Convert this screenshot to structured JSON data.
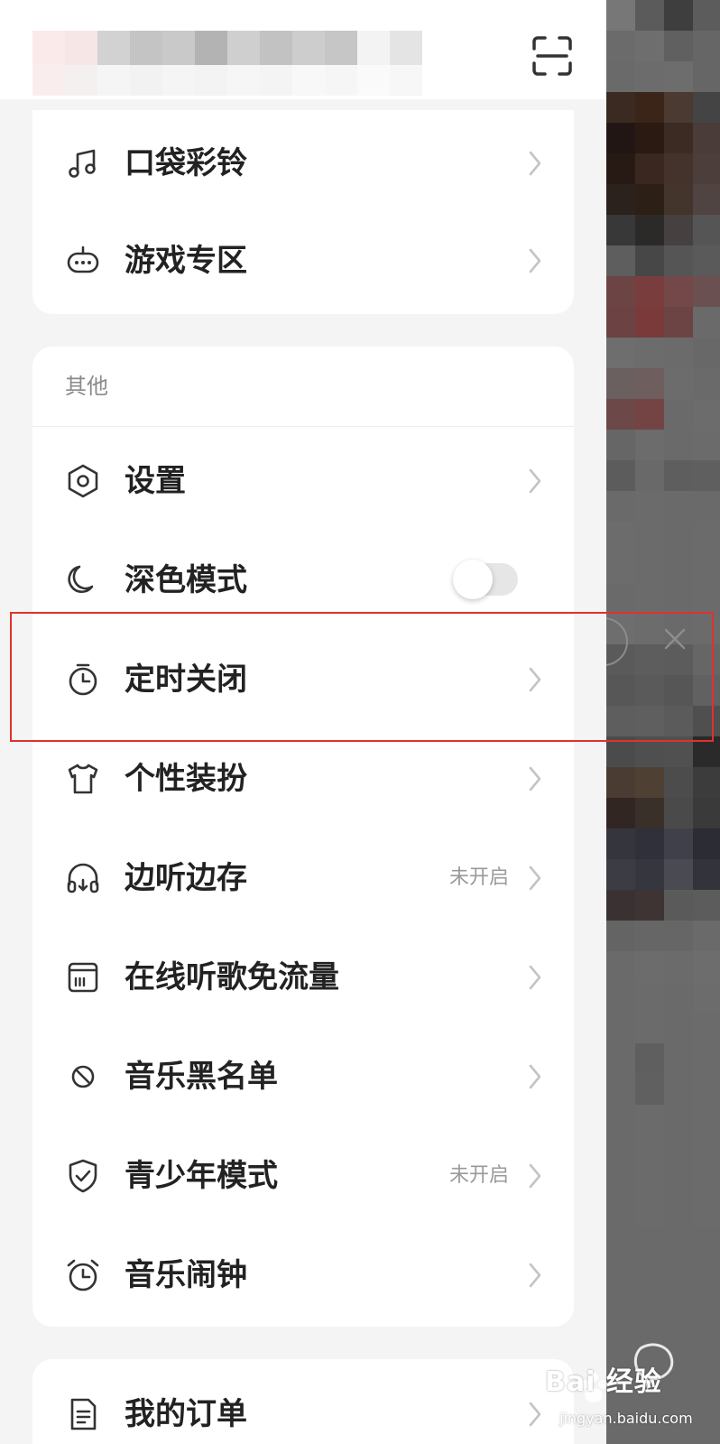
{
  "header": {
    "scan_icon": "scan-icon"
  },
  "top_section": {
    "items": [
      {
        "label": "口袋彩铃",
        "icon": "music-note-icon"
      },
      {
        "label": "游戏专区",
        "icon": "gamepad-icon"
      }
    ]
  },
  "others_section": {
    "title": "其他",
    "items": [
      {
        "label": "设置",
        "icon": "settings-hexagon-icon"
      },
      {
        "label": "深色模式",
        "icon": "moon-icon",
        "toggle_on": false
      },
      {
        "label": "定时关闭",
        "icon": "timer-icon"
      },
      {
        "label": "个性装扮",
        "icon": "tshirt-icon"
      },
      {
        "label": "边听边存",
        "icon": "headphones-icon",
        "status": "未开启"
      },
      {
        "label": "在线听歌免流量",
        "icon": "sim-card-icon"
      },
      {
        "label": "音乐黑名单",
        "icon": "block-icon"
      },
      {
        "label": "青少年模式",
        "icon": "shield-check-icon",
        "status": "未开启"
      },
      {
        "label": "音乐闹钟",
        "icon": "alarm-clock-icon"
      }
    ]
  },
  "bottom_section": {
    "items": [
      {
        "label": "我的订单",
        "icon": "document-icon"
      }
    ]
  },
  "watermark": {
    "brand": "Bai 经验",
    "url": "jingyan.baidu.com"
  },
  "colors": {
    "highlight": "#e0312f",
    "backdrop": "#6a6a6a",
    "card": "#ffffff",
    "page": "#f4f4f4"
  }
}
